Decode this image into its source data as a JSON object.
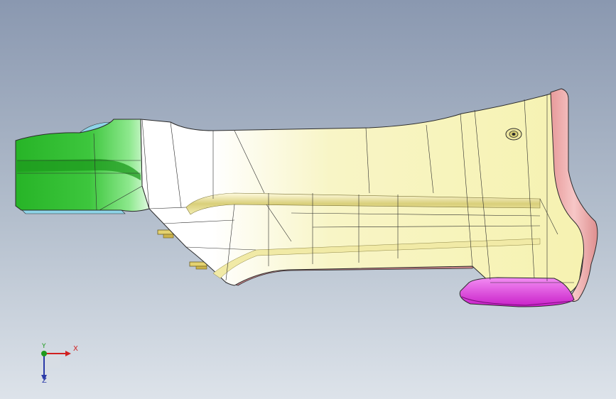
{
  "viewport": {
    "background_top": "#8a98b0",
    "background_bottom": "#dde3ea"
  },
  "model": {
    "faces": {
      "main_body": "#f6f3b4",
      "nose_cap": "#33c433",
      "flange_trim": "#eeaaaa",
      "bottom_rail": "#c9858a",
      "end_pad": "#de30de",
      "lower_blue": "#8ed4e8",
      "clip_tabs": "#e4d270",
      "edge_lines": "#2b2b2b"
    }
  },
  "triad": {
    "x_label": "X",
    "y_label": "Y",
    "z_label": "Z",
    "x_color": "#d02020",
    "y_color": "#1f9a1f",
    "z_color": "#2a3aa8"
  }
}
